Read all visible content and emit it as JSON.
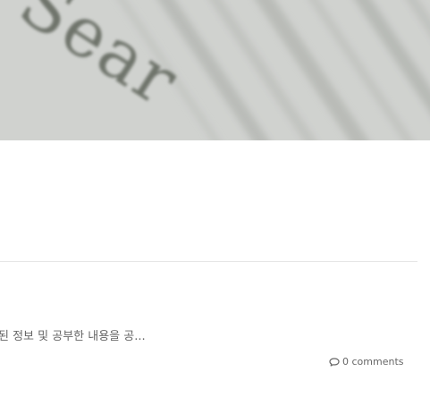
{
  "post": {
    "image": {
      "description_icon": "photo-of-printed-text",
      "visible_text": "Sear"
    },
    "excerpt": "된 정보 및 공부한 내용을 공...",
    "comments": {
      "icon": "comments-icon",
      "label": "0 comments"
    }
  },
  "colors": {
    "hero_base": "#c9cbc8",
    "hero_text": "#6f746c",
    "divider": "#e6e6e6",
    "text": "#666666"
  }
}
